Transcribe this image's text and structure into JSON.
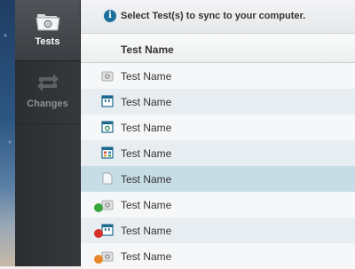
{
  "sidebar": {
    "items": [
      {
        "label": "Tests",
        "icon": "folder-gear-icon",
        "active": true
      },
      {
        "label": "Changes",
        "icon": "sync-arrows-icon",
        "active": false
      }
    ]
  },
  "main": {
    "info_text": "Select Test(s) to sync to your computer.",
    "info_icon": "info-icon",
    "column_header": "Test Name",
    "rows": [
      {
        "name": "Test Name",
        "icon": "folder-gear-icon",
        "status": null
      },
      {
        "name": "Test Name",
        "icon": "quote-doc-icon",
        "status": null
      },
      {
        "name": "Test Name",
        "icon": "gear-doc-icon",
        "status": null
      },
      {
        "name": "Test Name",
        "icon": "grid-doc-icon",
        "status": null
      },
      {
        "name": "Test Name",
        "icon": "blank-doc-icon",
        "status": null,
        "selected": true
      },
      {
        "name": "Test Name",
        "icon": "folder-gear-icon",
        "status": "green-check"
      },
      {
        "name": "Test Name",
        "icon": "quote-doc-icon",
        "status": "red-alert"
      },
      {
        "name": "Test Name",
        "icon": "folder-gear-icon",
        "status": "orange-alert"
      }
    ]
  },
  "colors": {
    "accent": "#1a6f9c",
    "selected_row": "#c7dde6",
    "sidebar_bg": "#303235"
  }
}
